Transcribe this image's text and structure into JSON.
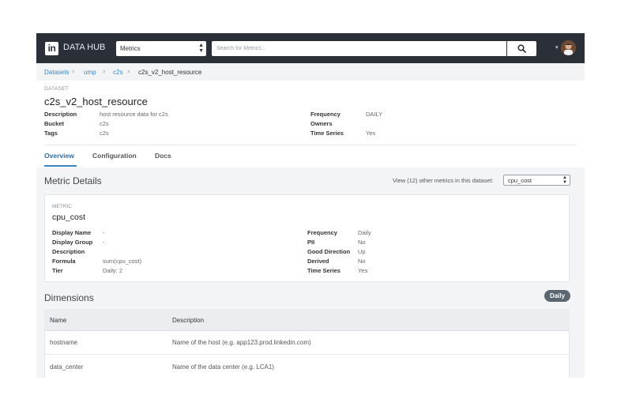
{
  "header": {
    "logo_text": "in",
    "brand": "DATA HUB",
    "metric_select": "Metrics",
    "search_placeholder": "Search for Metrics..."
  },
  "breadcrumb": [
    "Datasets",
    "ump",
    "c2s",
    "c2s_v2_host_resource"
  ],
  "dataset": {
    "kicker": "DATASET",
    "name": "c2s_v2_host_resource",
    "left": [
      {
        "label": "Description",
        "value": "host resource data for c2s"
      },
      {
        "label": "Bucket",
        "value": "c2s"
      },
      {
        "label": "Tags",
        "value": "c2s"
      }
    ],
    "right": [
      {
        "label": "Frequency",
        "value": "DAILY"
      },
      {
        "label": "Owners",
        "value": ""
      },
      {
        "label": "Time Series",
        "value": "Yes"
      }
    ]
  },
  "tabs": [
    "Overview",
    "Configuration",
    "Docs"
  ],
  "metric_details": {
    "title": "Metric Details",
    "view_text": "View (12) other metrics in this dataset:",
    "selected_metric": "cpu_cost",
    "kicker": "METRIC",
    "name": "cpu_cost",
    "left": [
      {
        "label": "Display Name",
        "value": "-"
      },
      {
        "label": "Display Group",
        "value": "-"
      },
      {
        "label": "Description",
        "value": ""
      },
      {
        "label": "Formula",
        "value": "sum(cpu_cost)"
      },
      {
        "label": "Tier",
        "value": "Daily: 2"
      }
    ],
    "right": [
      {
        "label": "Frequency",
        "value": "Daily"
      },
      {
        "label": "PII",
        "value": "No"
      },
      {
        "label": "Good Direction",
        "value": "Up"
      },
      {
        "label": "Derived",
        "value": "No"
      },
      {
        "label": "Time Series",
        "value": "Yes"
      }
    ]
  },
  "dimensions": {
    "title": "Dimensions",
    "badge": "Daily",
    "columns": [
      "Name",
      "Description"
    ],
    "rows": [
      {
        "name": "hostname",
        "description": "Name of the host (e.g. app123.prod.linkedin.com)"
      },
      {
        "name": "data_center",
        "description": "Name of the data center (e.g. LCA1)"
      }
    ]
  }
}
